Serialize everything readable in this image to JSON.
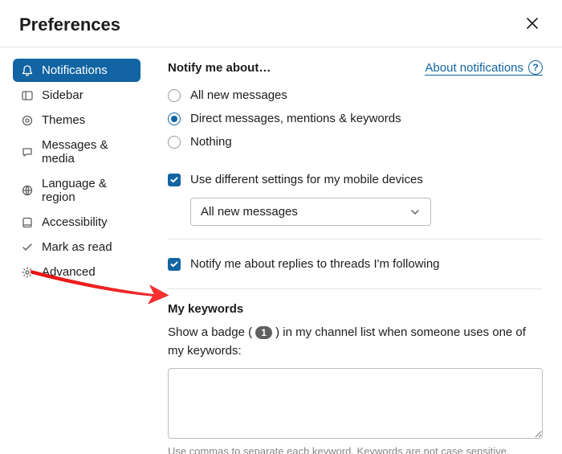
{
  "header": {
    "title": "Preferences"
  },
  "sidebar": {
    "items": [
      {
        "label": "Notifications",
        "active": true
      },
      {
        "label": "Sidebar"
      },
      {
        "label": "Themes"
      },
      {
        "label": "Messages & media"
      },
      {
        "label": "Language & region"
      },
      {
        "label": "Accessibility"
      },
      {
        "label": "Mark as read"
      },
      {
        "label": "Advanced"
      }
    ]
  },
  "notify": {
    "title": "Notify me about…",
    "help_link": "About notifications",
    "options": {
      "all": "All new messages",
      "dm": "Direct messages, mentions & keywords",
      "nothing": "Nothing"
    },
    "selected": "dm",
    "mobile_check": "Use different settings for my mobile devices",
    "mobile_select": "All new messages",
    "threads_check": "Notify me about replies to threads I'm following"
  },
  "keywords": {
    "title": "My keywords",
    "desc_before": "Show a badge (",
    "badge": "1",
    "desc_after": ") in my channel list when someone uses one of my keywords:",
    "value": "",
    "hint": "Use commas to separate each keyword. Keywords are not case sensitive."
  }
}
